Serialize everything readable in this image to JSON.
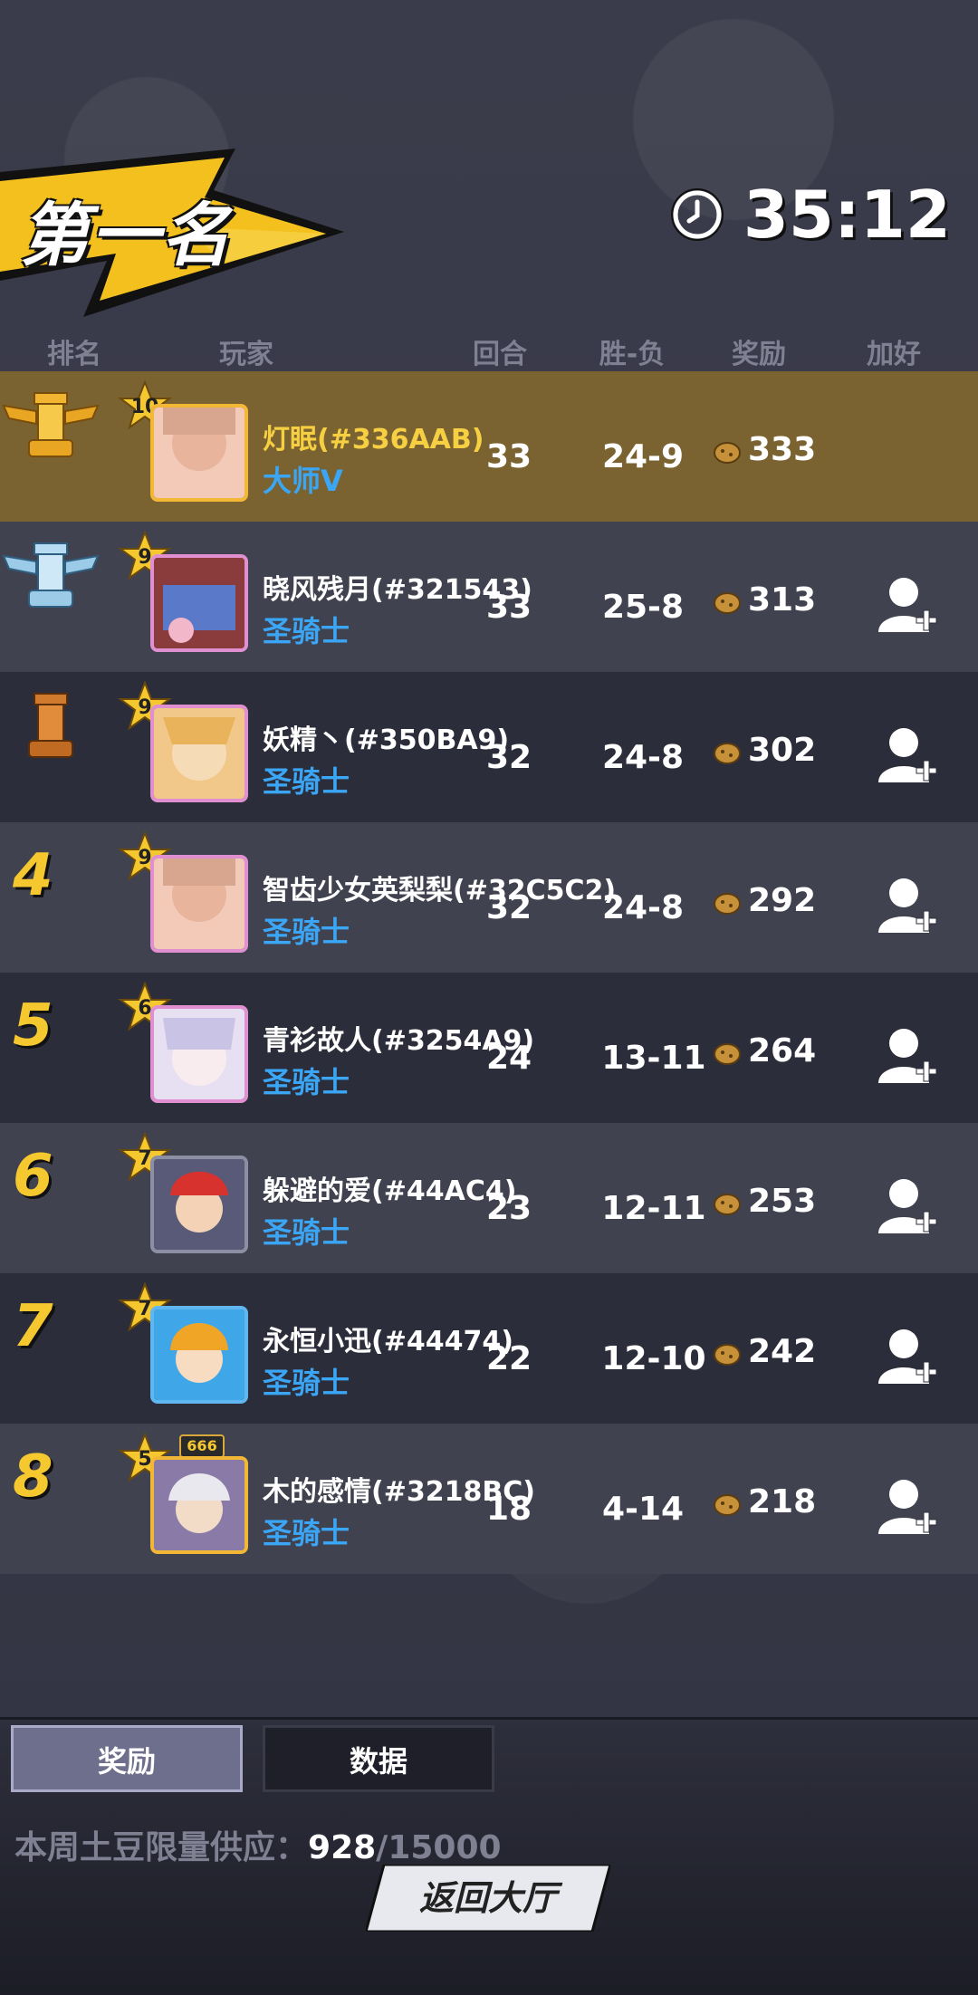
{
  "header": {
    "rank_title": "第一名",
    "timer": "35:12"
  },
  "columns": {
    "rank": "排名",
    "player": "玩家",
    "round": "回合",
    "win_loss": "胜-负",
    "reward": "奖励",
    "add_friend": "加好友"
  },
  "rows": [
    {
      "rank": "1",
      "level": "10",
      "name": "灯眠(#336AAB)",
      "title": "大师V",
      "round": "33",
      "win_loss": "24-9",
      "reward": "333"
    },
    {
      "rank": "2",
      "level": "9",
      "name": "晓风残月(#321543)",
      "title": "圣骑士",
      "round": "33",
      "win_loss": "25-8",
      "reward": "313"
    },
    {
      "rank": "3",
      "level": "9",
      "name": "妖精丶(#350BA9)",
      "title": "圣骑士",
      "round": "32",
      "win_loss": "24-8",
      "reward": "302"
    },
    {
      "rank": "4",
      "level": "9",
      "name": "智齿少女英梨梨(#32C5C2)",
      "title": "圣骑士",
      "round": "32",
      "win_loss": "24-8",
      "reward": "292"
    },
    {
      "rank": "5",
      "level": "6",
      "name": "青衫故人(#3254A9)",
      "title": "圣骑士",
      "round": "24",
      "win_loss": "13-11",
      "reward": "264"
    },
    {
      "rank": "6",
      "level": "7",
      "name": "躲避的爱(#44AC4)",
      "title": "圣骑士",
      "round": "23",
      "win_loss": "12-11",
      "reward": "253"
    },
    {
      "rank": "7",
      "level": "7",
      "name": "永恒小迅(#44474)",
      "title": "圣骑士",
      "round": "22",
      "win_loss": "12-10",
      "reward": "242"
    },
    {
      "rank": "8",
      "level": "5",
      "badge": "666",
      "name": "木的感情(#3218BC)",
      "title": "圣骑士",
      "round": "18",
      "win_loss": "4-14",
      "reward": "218"
    }
  ],
  "bottom": {
    "tab_reward": "奖励",
    "tab_data": "数据",
    "supply_label": "本周土豆限量供应：",
    "supply_current": "928",
    "supply_max": "/15000",
    "return_button": "返回大厅"
  },
  "colors": {
    "gold_row": "#7a6330",
    "accent_yellow": "#f5c830",
    "title_blue": "#3aa6f5"
  }
}
